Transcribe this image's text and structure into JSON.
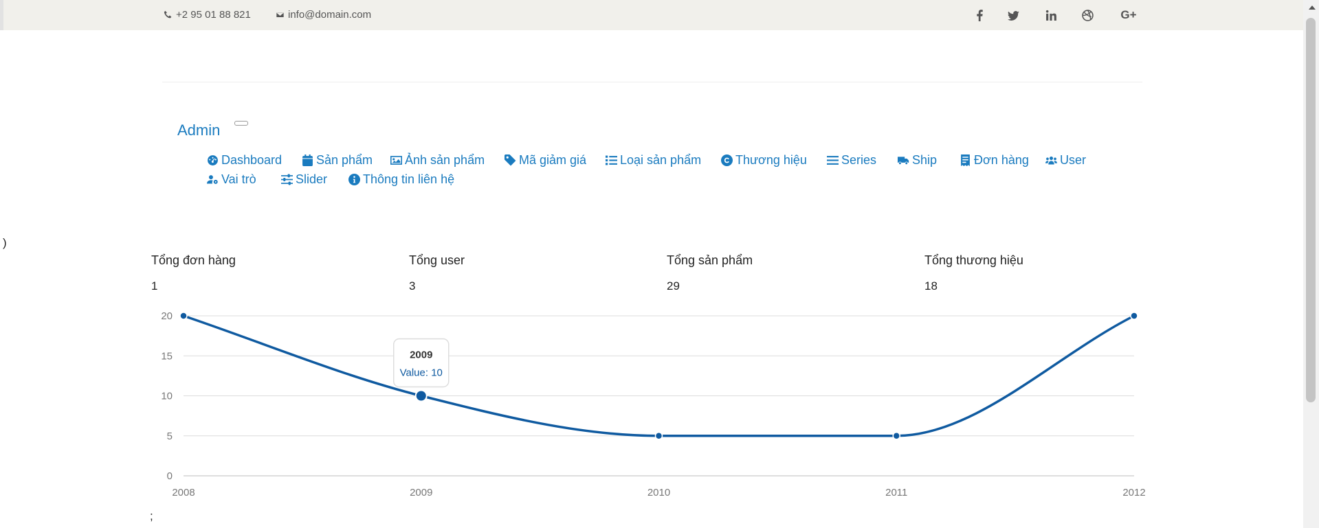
{
  "topbar": {
    "phone": "+2 95 01 88 821",
    "email": "info@domain.com",
    "social_icons": [
      "facebook-icon",
      "twitter-icon",
      "linkedin-icon",
      "dribbble-icon",
      "google-plus-icon"
    ],
    "google_plus_text": "G+"
  },
  "nav": {
    "brand": "Admin",
    "items": [
      {
        "label": "Dashboard",
        "icon": "gauge-icon"
      },
      {
        "label": "Sản phẩm",
        "icon": "calendar-icon"
      },
      {
        "label": "Ảnh sản phẩm",
        "icon": "image-icon"
      },
      {
        "label": "Mã giảm giá",
        "icon": "tag-icon"
      },
      {
        "label": "Loại sản phẩm",
        "icon": "list-icon"
      },
      {
        "label": "Thương hiệu",
        "icon": "copyright-icon"
      },
      {
        "label": "Series",
        "icon": "bars-icon"
      },
      {
        "label": "Ship",
        "icon": "truck-icon"
      },
      {
        "label": "Đơn hàng",
        "icon": "receipt-icon"
      },
      {
        "label": "User",
        "icon": "users-icon"
      },
      {
        "label": "Vai trò",
        "icon": "user-gear-icon"
      },
      {
        "label": "Slider",
        "icon": "sliders-icon"
      },
      {
        "label": "Thông tin liên hệ",
        "icon": "info-icon"
      }
    ]
  },
  "stray": {
    "paren": ")",
    "semicolon": ";"
  },
  "stats": [
    {
      "label": "Tổng đơn hàng",
      "value": "1"
    },
    {
      "label": "Tổng user",
      "value": "3"
    },
    {
      "label": "Tổng sản phẩm",
      "value": "29"
    },
    {
      "label": "Tổng thương hiệu",
      "value": "18"
    }
  ],
  "colors": {
    "accent": "#1a7bbf",
    "line": "#0f5aa0",
    "topbar": "#f1f0eb"
  },
  "chart_data": {
    "type": "line",
    "x": [
      "2008",
      "2009",
      "2010",
      "2011",
      "2012"
    ],
    "series": [
      {
        "values": [
          20,
          10,
          5,
          5,
          20
        ]
      }
    ],
    "ylim": [
      0,
      20
    ],
    "yticks": [
      "0",
      "5",
      "10",
      "15",
      "20"
    ],
    "grid": true,
    "tooltip": {
      "title": "2009",
      "text": "Value: 10",
      "index": 1
    }
  }
}
